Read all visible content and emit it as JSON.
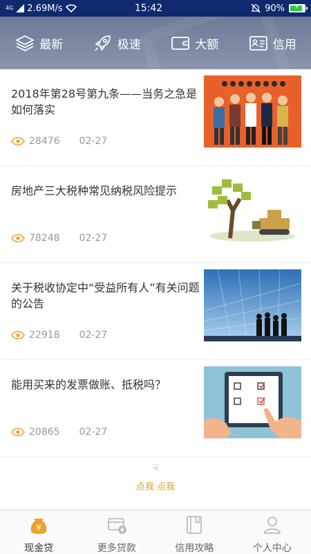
{
  "status": {
    "signal": "4G",
    "speed": "2.69M/s",
    "time": "15:42",
    "battery": "90%",
    "battery_level": 0.9
  },
  "categories": [
    {
      "label": "最新",
      "icon": "layers-icon"
    },
    {
      "label": "极速",
      "icon": "rocket-icon"
    },
    {
      "label": "大额",
      "icon": "wallet-icon"
    },
    {
      "label": "信用",
      "icon": "id-card-icon"
    }
  ],
  "articles": [
    {
      "title": "2018年第28号第九条——当务之急是如何落实",
      "views": "28476",
      "date": "02-27",
      "thumb": "people-illustration"
    },
    {
      "title": "房地产三大税种常见纳税风险提示",
      "views": "78248",
      "date": "02-27",
      "thumb": "money-tree-bulldozer"
    },
    {
      "title": "关于税收协定中“受益所有人”有关问题的公告",
      "views": "22918",
      "date": "02-27",
      "thumb": "building-silhouettes"
    },
    {
      "title": "能用买来的发票做账、抵税吗？",
      "views": "20865",
      "date": "02-27",
      "thumb": "tablet-checklist"
    }
  ],
  "load_more": {
    "label": "点我 点我",
    "icon": "pointing-hand-icon"
  },
  "tabs": [
    {
      "label": "现金贷",
      "icon": "yen-bag-icon",
      "active": true
    },
    {
      "label": "更多贷款",
      "icon": "card-plus-icon",
      "active": false
    },
    {
      "label": "信用攻略",
      "icon": "book-icon",
      "active": false
    },
    {
      "label": "个人中心",
      "icon": "person-icon",
      "active": false
    }
  ],
  "colors": {
    "accent": "#f0a127",
    "header": "#7b86a0",
    "statusbar": "#0f2a6e"
  }
}
